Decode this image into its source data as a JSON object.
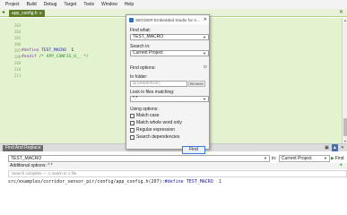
{
  "menubar": {
    "items": [
      "Project",
      "Build",
      "Debug",
      "Target",
      "Tools",
      "Window",
      "Help"
    ]
  },
  "editor": {
    "tab_label": "app_config.h",
    "lines": [
      {
        "num": "203",
        "parts": []
      },
      {
        "num": "204",
        "parts": []
      },
      {
        "num": "205",
        "parts": []
      },
      {
        "num": "206",
        "parts": []
      },
      {
        "num": "207",
        "parts": [
          [
            "kw",
            "#define "
          ],
          [
            "mac",
            "TEST_MACRO"
          ],
          [
            "num",
            "  1"
          ]
        ]
      },
      {
        "num": "208",
        "parts": [
          [
            "kw",
            "#endif "
          ],
          [
            "cmt",
            "/* APP_CONFIG_H__ */"
          ]
        ]
      },
      {
        "num": "209",
        "parts": []
      },
      {
        "num": "210",
        "parts": []
      },
      {
        "num": "211",
        "parts": []
      }
    ]
  },
  "dialog": {
    "title": "SEGGER Embedded Studio for A...",
    "find_what_label": "Find what:",
    "find_what_value": "TEST_MACRO",
    "search_in_label": "Search in:",
    "search_in_value": "Current Project",
    "find_options_label": "Find options:",
    "in_folder_label": "In folder:",
    "in_folder_value": "$(SolutionDir)",
    "browse_label": "Browse",
    "look_in_label": "Look in files matching:",
    "look_in_value": "*.*",
    "using_options_label": "Using options:",
    "options": [
      "Match case",
      "Match whole word only",
      "Regular expression",
      "Search dependencies"
    ],
    "find_button": "Find"
  },
  "find_panel": {
    "title": "Find And Replace",
    "search_value": "TEST_MACRO",
    "in_label": "in:",
    "scope_value": "Current Project",
    "find_label": "Find",
    "additional_options": "Additional options: *.*",
    "summary": "Search complete — 1 match in 1 file",
    "result_path": "src/examples/corridor_sensor_pir/config/app_config.h(207):",
    "result_code": "#define TEST_MACRO  1"
  }
}
